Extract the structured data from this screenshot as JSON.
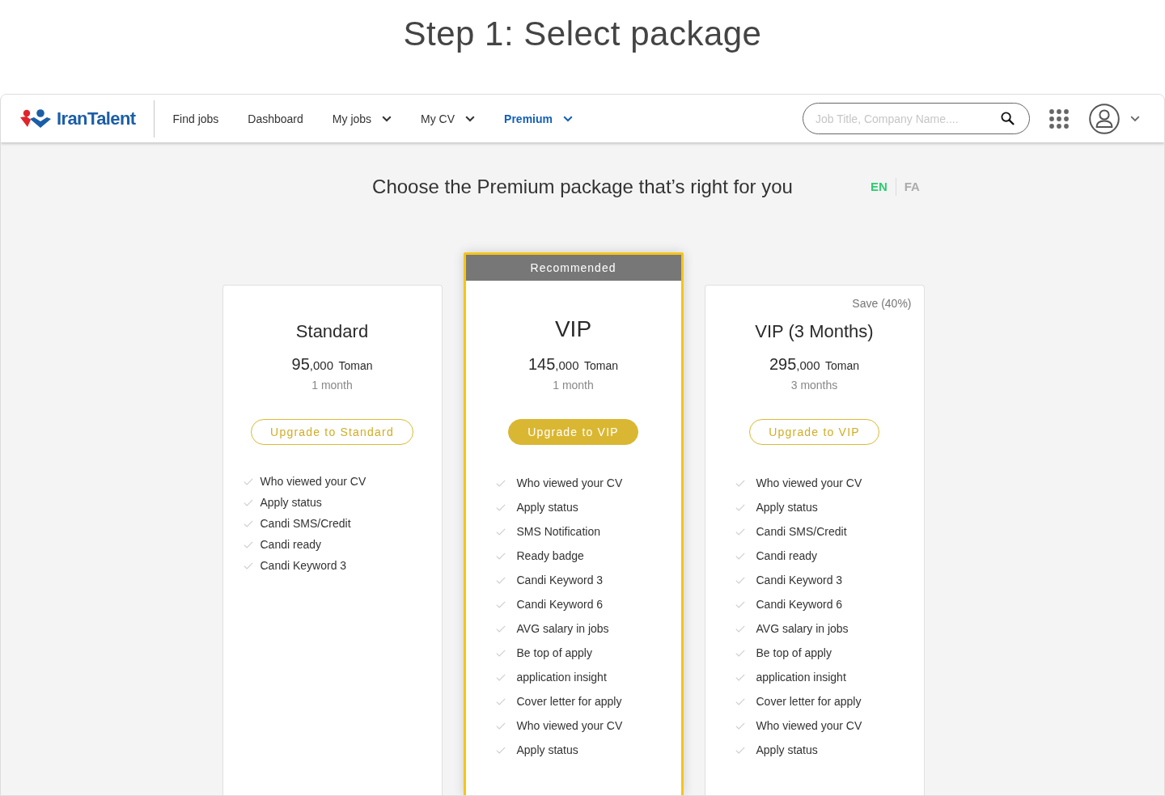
{
  "page_title": "Step 1: Select package",
  "navbar": {
    "logo": "IranTalent",
    "items": [
      {
        "label": "Find jobs",
        "dropdown": false,
        "selected": false
      },
      {
        "label": "Dashboard",
        "dropdown": false,
        "selected": false
      },
      {
        "label": "My jobs",
        "dropdown": true,
        "selected": false
      },
      {
        "label": "My CV",
        "dropdown": true,
        "selected": false
      },
      {
        "label": "Premium",
        "dropdown": true,
        "selected": true
      }
    ],
    "search": {
      "placeholder": "Job Title, Company Name...."
    }
  },
  "heading": "Choose the Premium package that’s right for you",
  "languages": [
    {
      "label": "EN",
      "selected": true
    },
    {
      "label": "FA",
      "selected": false
    }
  ],
  "packages": [
    {
      "name": "Standard",
      "recommended": false,
      "price_major": "95",
      "price_minor": ",000",
      "currency": "Toman",
      "period": "1 month",
      "button": "Upgrade to Standard",
      "features": [
        "Who viewed your CV",
        "Apply status",
        "Candi SMS/Credit",
        "Candi ready",
        "Candi Keyword 3"
      ]
    },
    {
      "name": "VIP",
      "recommended": true,
      "badge": "Recommended",
      "price_major": "145",
      "price_minor": ",000",
      "currency": "Toman",
      "period": "1 month",
      "button": "Upgrade to VIP",
      "features": [
        "Who viewed your CV",
        "Apply status",
        "SMS Notification",
        "Ready badge",
        "Candi Keyword 3",
        "Candi Keyword 6",
        "AVG salary in jobs",
        "Be top of apply",
        "application insight",
        "Cover letter for apply",
        "Who viewed your CV",
        "Apply status"
      ]
    },
    {
      "name": "VIP (3 Months)",
      "recommended": false,
      "note": "Save (40%)",
      "price_major": "295",
      "price_minor": ",000",
      "currency": "Toman",
      "period": "3 months",
      "button": "Upgrade to VIP",
      "features": [
        "Who viewed your CV",
        "Apply status",
        "Candi SMS/Credit",
        "Candi ready",
        "Candi Keyword 3",
        "Candi Keyword 6",
        "AVG salary in jobs",
        "Be top of apply",
        "application insight",
        "Cover letter for apply",
        "Who viewed your CV",
        "Apply status"
      ]
    }
  ]
}
